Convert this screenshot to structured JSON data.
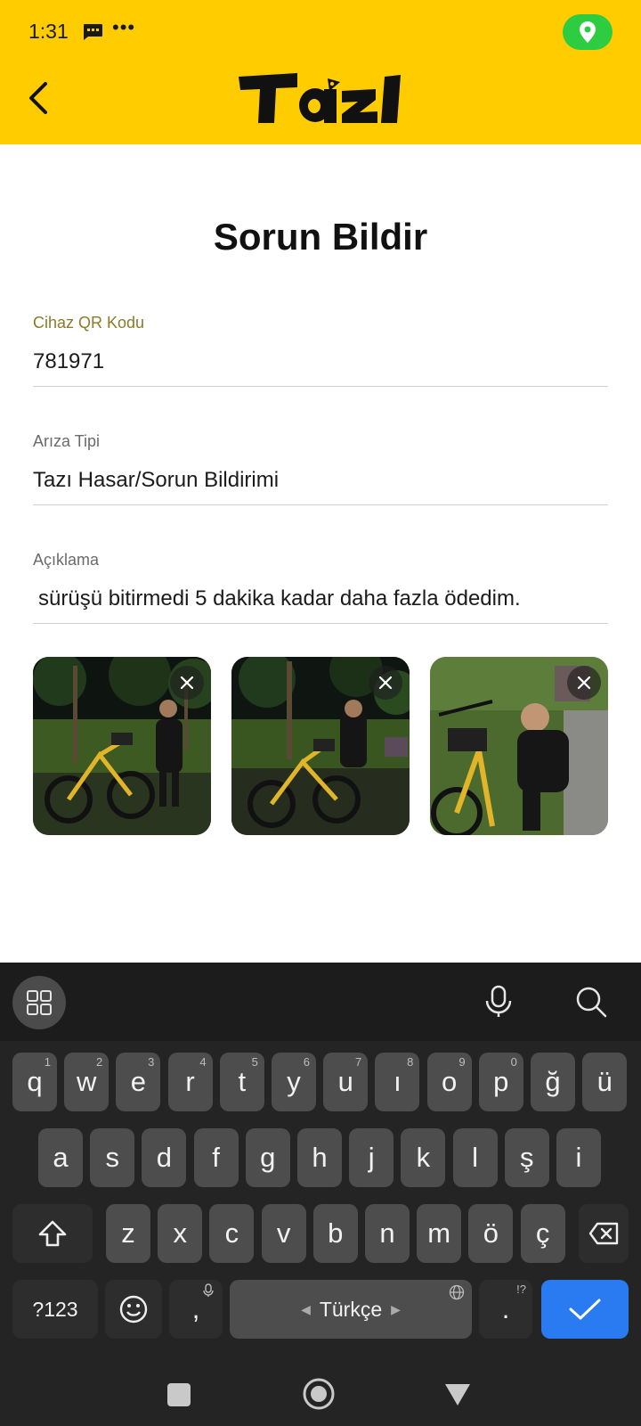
{
  "status_bar": {
    "time": "1:31",
    "dots": "•••"
  },
  "header": {
    "logo_text": "TaZI"
  },
  "form": {
    "title": "Sorun Bildir",
    "qr_label": "Cihaz QR Kodu",
    "qr_value": "781971",
    "fault_label": "Arıza Tipi",
    "fault_value": "Tazı Hasar/Sorun Bildirimi",
    "desc_label": "Açıklama",
    "desc_value": "sürüşü bitirmedi 5 dakika kadar daha fazla ödedim."
  },
  "photos": [
    {
      "id": "photo-1",
      "remove_icon": "close-icon"
    },
    {
      "id": "photo-2",
      "remove_icon": "close-icon"
    },
    {
      "id": "photo-3",
      "remove_icon": "close-icon"
    }
  ],
  "keyboard": {
    "row1": [
      "q",
      "w",
      "e",
      "r",
      "t",
      "y",
      "u",
      "ı",
      "o",
      "p",
      "ğ",
      "ü"
    ],
    "row1_hints": [
      "1",
      "2",
      "3",
      "4",
      "5",
      "6",
      "7",
      "8",
      "9",
      "0",
      "",
      ""
    ],
    "row2": [
      "a",
      "s",
      "d",
      "f",
      "g",
      "h",
      "j",
      "k",
      "l",
      "ş",
      "i"
    ],
    "row3": [
      "z",
      "x",
      "c",
      "v",
      "b",
      "n",
      "m",
      "ö",
      "ç"
    ],
    "symbols_label": "?123",
    "comma": ",",
    "period": ".",
    "period_hint": "!?",
    "space_label": "Türkçe",
    "accent_color": "#2A7BF2"
  },
  "colors": {
    "header": "#FFCC00",
    "location": "#2ECC40"
  }
}
